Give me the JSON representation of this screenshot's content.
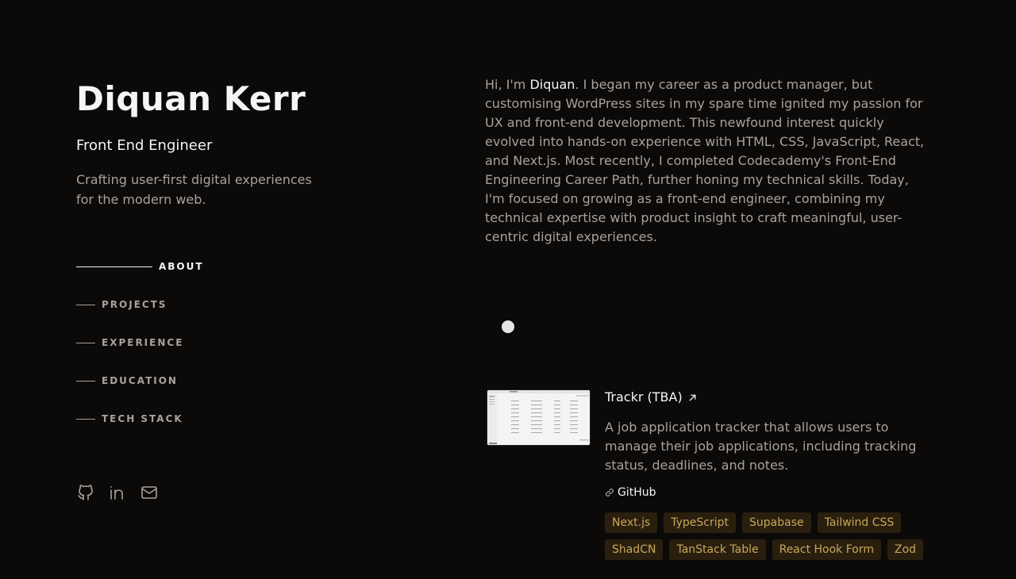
{
  "profile": {
    "name": "Diquan Kerr",
    "role": "Front End Engineer",
    "tagline": "Crafting user-first digital experiences for the modern web."
  },
  "nav": {
    "items": [
      {
        "label": "ABOUT",
        "active": true
      },
      {
        "label": "PROJECTS",
        "active": false
      },
      {
        "label": "EXPERIENCE",
        "active": false
      },
      {
        "label": "EDUCATION",
        "active": false
      },
      {
        "label": "TECH STACK",
        "active": false
      }
    ]
  },
  "socials": {
    "icons": [
      "github-icon",
      "linkedin-icon",
      "mail-icon"
    ]
  },
  "about": {
    "prefix": "Hi, I'm ",
    "name": "Diquan",
    "text": ". I began my career as a product manager, but customising WordPress sites in my spare time ignited my passion for UX and front-end development. This newfound interest quickly evolved into hands-on experience with HTML, CSS, JavaScript, React, and Next.js. Most recently, I completed Codecademy's Front-End Engineering Career Path, further honing my technical skills. Today, I'm focused on growing as a front-end engineer, combining my technical expertise with product insight to craft meaningful, user-centric digital experiences."
  },
  "project": {
    "title": "Trackr (TBA)",
    "description": "A job application tracker that allows users to manage their job applications, including tracking status, deadlines, and notes.",
    "link_label": "GitHub",
    "tags": [
      "Next.js",
      "TypeScript",
      "Supabase",
      "Tailwind CSS",
      "ShadCN",
      "TanStack Table",
      "React Hook Form",
      "Zod"
    ]
  },
  "colors": {
    "background": "#0b0a09",
    "text_primary": "#f5f5f4",
    "text_muted": "#a8a29e",
    "tag_bg": "#2a1f0e",
    "tag_text": "#c9a65a"
  }
}
